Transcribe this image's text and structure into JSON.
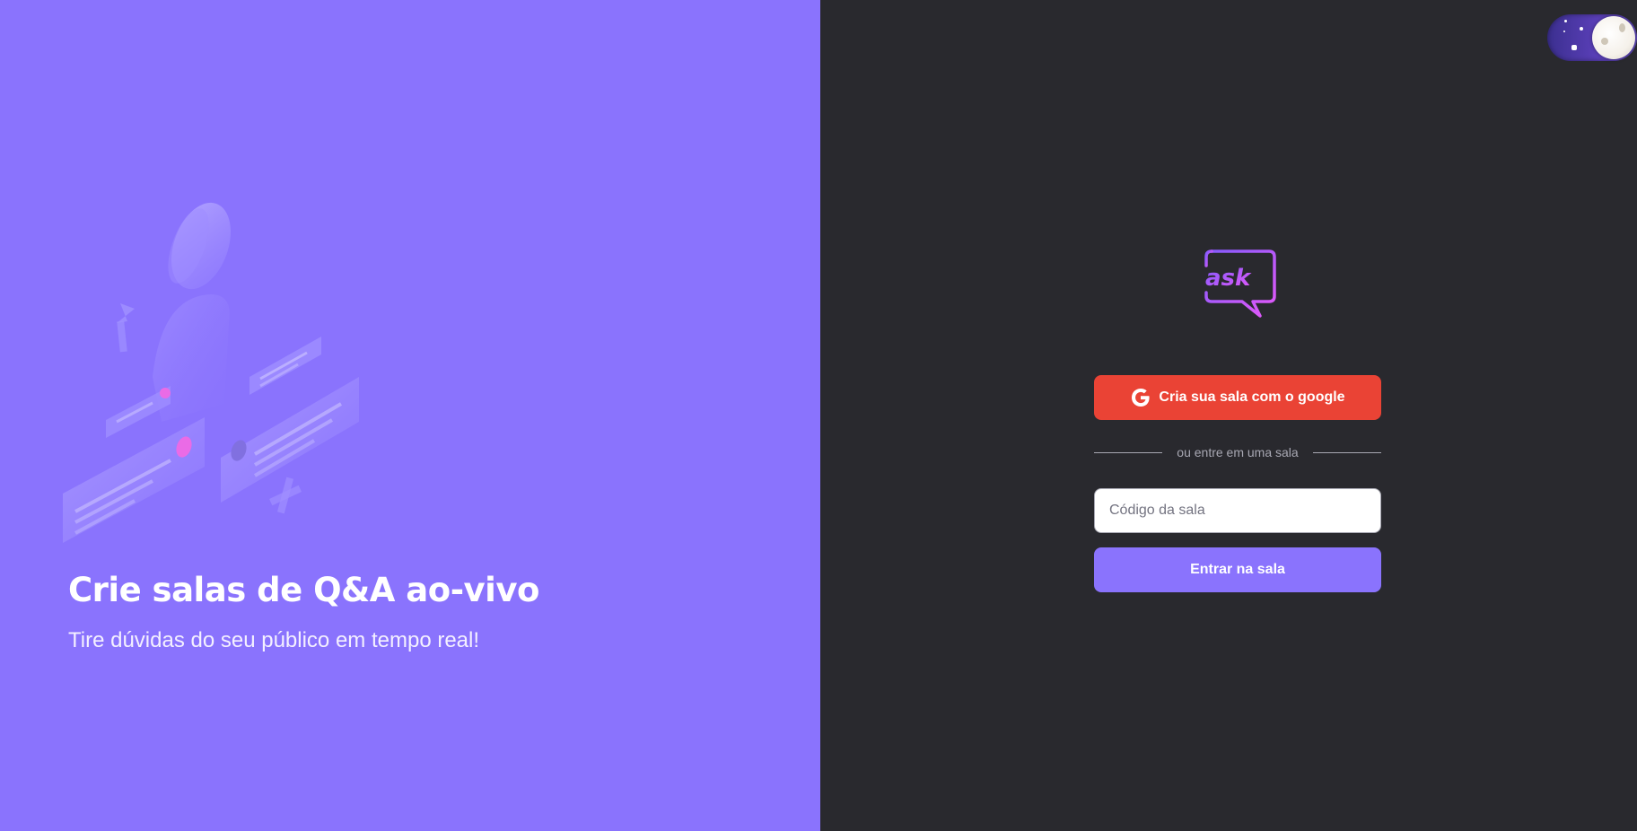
{
  "aside": {
    "title": "Crie salas de Q&A ao-vivo",
    "subtitle": "Tire dúvidas do seu público em tempo real!",
    "illustration": "illustration-icon"
  },
  "header": {
    "theme_toggle": "moon-icon"
  },
  "main": {
    "logo_text": "ask",
    "google_button_label": "Cria sua sala com o google",
    "google_icon": "google-icon",
    "separator_text": "ou entre em uma sala",
    "room_code_placeholder": "Código da sala",
    "room_code_value": "",
    "enter_button_label": "Entrar na sala"
  },
  "colors": {
    "aside_background": "#8a73fd",
    "main_background": "#29292e",
    "google_button": "#ea4335",
    "primary_button": "#8a73fd"
  }
}
